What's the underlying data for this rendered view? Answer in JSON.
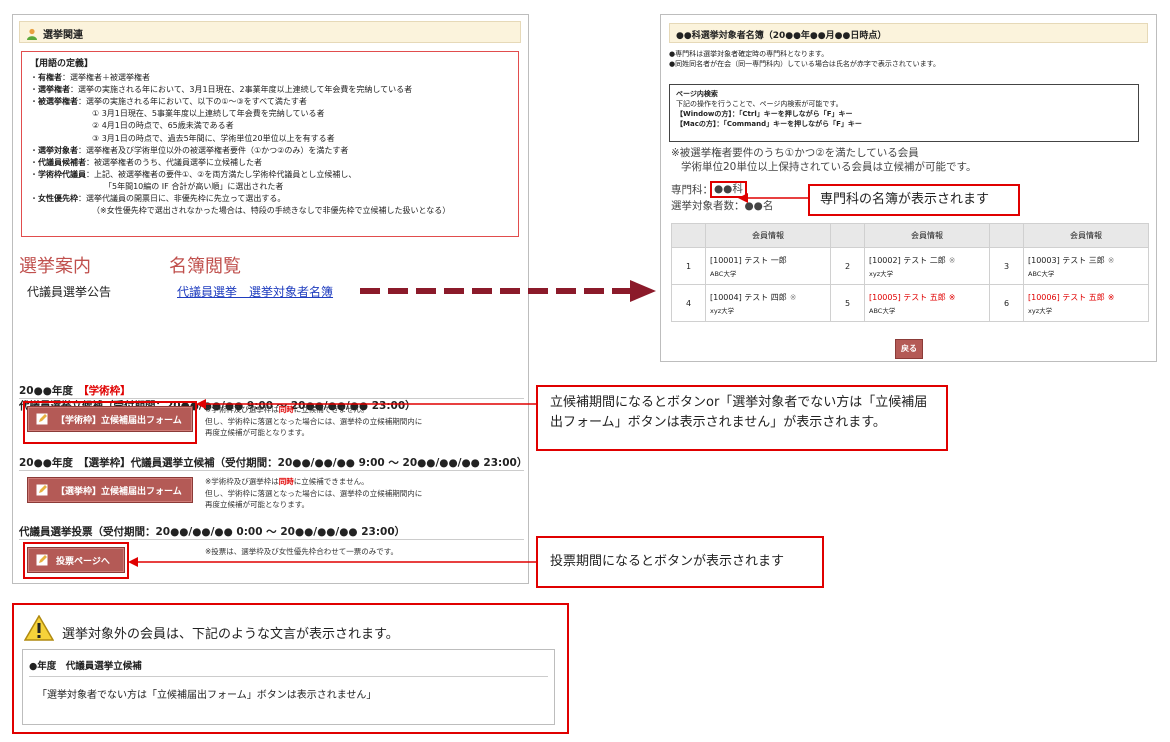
{
  "left": {
    "section_title": "選挙関連",
    "terms": {
      "title": "【用語の定義】",
      "rows": [
        {
          "term": "有権者",
          "desc": "：選挙権者＋被選挙権者"
        },
        {
          "term": "選挙権者",
          "desc": "：選挙の実施される年において、3月1日現在、2事業年度以上連続して年会費を完納している者"
        },
        {
          "term": "被選挙権者",
          "desc": "：選挙の実施される年において、以下の①～③をすべて満たす者"
        }
      ],
      "sub1": "① 3月1日現在、5事業年度以上連続して年会費を完納している者",
      "sub2": "② 4月1日の時点で、65歳未満である者",
      "sub3": "③ 3月1日の時点で、過去5年間に、学術単位20単位以上を有する者",
      "rows2": [
        {
          "term": "選挙対象者",
          "desc": "：選挙権者及び学術単位以外の被選挙権者要件（①かつ②のみ）を満たす者"
        },
        {
          "term": "代議員候補者",
          "desc": "：被選挙権者のうち、代議員選挙に立候補した者"
        },
        {
          "term": "学術枠代議員",
          "desc": "：上記、被選挙権者の要件①、②を両方満たし学術枠代議員とし立候補し、"
        }
      ],
      "sub4": "「5年間10編の IF 合計が高い順」に選出された者",
      "rows3": [
        {
          "term": "女性優先枠",
          "desc": "：選挙代議員の開票日に、非優先枠に先立って選出する。"
        }
      ],
      "sub5": "（※女性優先枠で選出されなかった場合は、特段の手続きなしで非優先枠で立候補した扱いとなる）"
    },
    "election_info_heading": "選挙案内",
    "roster_heading": "名簿閲覧",
    "announcement_text": "代議員選挙公告",
    "roster_link": "代議員選挙　選挙対象者名簿",
    "period1": {
      "prefix": "20●●年度　",
      "highlight": "【学術枠】",
      "rest": "代議員選挙立候補（受付期間：20●●/●●/●● 9:00 ～ 20●●/●●/●● 23:00）"
    },
    "btn1_label": "【学術枠】立候補届出フォーム",
    "note1_a": "※学術枠及び選挙枠は",
    "note1_red": "同時",
    "note1_b": "に立候補できません。",
    "note1_line2": "但し、学術枠に落選となった場合には、選挙枠の立候補期間内に",
    "note1_line3": "再度立候補が可能となります。",
    "period2": "20●●年度　【選挙枠】代議員選挙立候補（受付期間：20●●/●●/●● 9:00 ～ 20●●/●●/●● 23:00）",
    "btn2_label": "【選挙枠】立候補届出フォーム",
    "note2_a": "※学術枠及び選挙枠は",
    "note2_red": "同時",
    "note2_b": "に立候補できません。",
    "note2_line2": "但し、学術枠に落選となった場合には、選挙枠の立候補期間内に",
    "note2_line3": "再度立候補が可能となります。",
    "period3": "代議員選挙投票（受付期間：20●●/●●/●● 0:00 ～ 20●●/●●/●● 23:00）",
    "btn3_label": "投票ページへ",
    "note3": "※投票は、選挙枠及び女性優先枠合わせて一票のみです。"
  },
  "right": {
    "title": "●●科選挙対象者名簿（20●●年●●月●●日時点）",
    "note_a": "●専門科は選挙対象者確定時の専門科となります。",
    "note_b": "●同姓同名者が在会（同一専門科内）している場合は氏名が赤字で表示されています。",
    "search_title": "ページ内検索",
    "search_desc": "下記の操作を行うことで、ページ内検索が可能です。",
    "search_win": "【Windowの方】：「Ctrl」キーを押しながら「F」キー",
    "search_mac": "【Macの方】：「Command」キーを押しながら「F」キー",
    "req_line1": "※被選挙権者要件のうち①かつ②を満たしている会員",
    "req_line2": "学術単位20単位以上保持されている会員は立候補が可能です。",
    "dept_label": "専門科：",
    "dept_value": "●●科",
    "count_label": "選挙対象者数：●●名",
    "table_header": "会員情報",
    "rows": [
      [
        {
          "num": "1",
          "name": "[10001] テスト 一郎",
          "mark": "",
          "school": "ABC大学",
          "red": false
        },
        {
          "num": "2",
          "name": "[10002] テスト 二郎",
          "mark": "※",
          "school": "xyz大学",
          "red": false
        },
        {
          "num": "3",
          "name": "[10003] テスト 三郎",
          "mark": "※",
          "school": "ABC大学",
          "red": false
        }
      ],
      [
        {
          "num": "4",
          "name": "[10004] テスト 四郎",
          "mark": "※",
          "school": "xyz大学",
          "red": false
        },
        {
          "num": "5",
          "name": "[10005] テスト 五郎",
          "mark": "※",
          "school": "ABC大学",
          "red": true
        },
        {
          "num": "6",
          "name": "[10006] テスト 五郎",
          "mark": "※",
          "school": "xyz大学",
          "red": true
        }
      ]
    ],
    "back_label": "戻る"
  },
  "callouts": {
    "dept_callout": "専門科の名簿が表示されます",
    "button_callout": "立候補期間になるとボタンor「選挙対象者でない方は「立候補届出フォーム」ボタンは表示されません」が表示されます。",
    "vote_callout": "投票期間になるとボタンが表示されます"
  },
  "warning": {
    "message": "選挙対象外の会員は、下記のような文言が表示されます。",
    "box_title": "●年度　代議員選挙立候補",
    "box_text": "「選挙対象者でない方は「立候補届出フォーム」ボタンは表示されません」"
  },
  "colors": {
    "accent_red": "#e00000",
    "button_brown": "#b45a56",
    "header_beige": "#fbf3dc",
    "link_blue": "#1f3dbf"
  }
}
